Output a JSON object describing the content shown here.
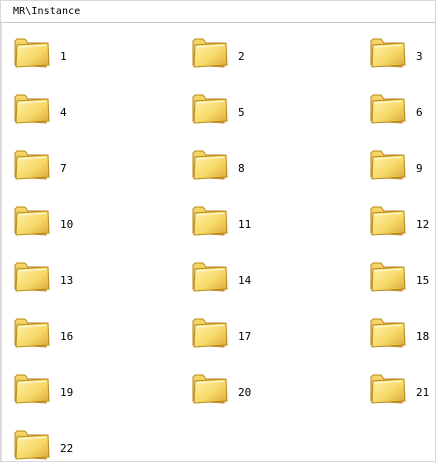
{
  "window": {
    "path": "MR\\Instance"
  },
  "folders": [
    {
      "label": "1",
      "icon": "folder-icon"
    },
    {
      "label": "2",
      "icon": "folder-icon"
    },
    {
      "label": "3",
      "icon": "folder-icon"
    },
    {
      "label": "4",
      "icon": "folder-icon"
    },
    {
      "label": "5",
      "icon": "folder-icon"
    },
    {
      "label": "6",
      "icon": "folder-icon"
    },
    {
      "label": "7",
      "icon": "folder-icon"
    },
    {
      "label": "8",
      "icon": "folder-icon"
    },
    {
      "label": "9",
      "icon": "folder-icon"
    },
    {
      "label": "10",
      "icon": "folder-icon"
    },
    {
      "label": "11",
      "icon": "folder-icon"
    },
    {
      "label": "12",
      "icon": "folder-icon"
    },
    {
      "label": "13",
      "icon": "folder-icon"
    },
    {
      "label": "14",
      "icon": "folder-icon"
    },
    {
      "label": "15",
      "icon": "folder-icon"
    },
    {
      "label": "16",
      "icon": "folder-icon"
    },
    {
      "label": "17",
      "icon": "folder-icon"
    },
    {
      "label": "18",
      "icon": "folder-icon"
    },
    {
      "label": "19",
      "icon": "folder-icon"
    },
    {
      "label": "20",
      "icon": "folder-icon"
    },
    {
      "label": "21",
      "icon": "folder-icon"
    },
    {
      "label": "22",
      "icon": "folder-icon"
    }
  ],
  "colors": {
    "folder_light": "#fff3a8",
    "folder_mid": "#f7d96a",
    "folder_dark": "#d8a936",
    "folder_outline": "#b8891e"
  }
}
